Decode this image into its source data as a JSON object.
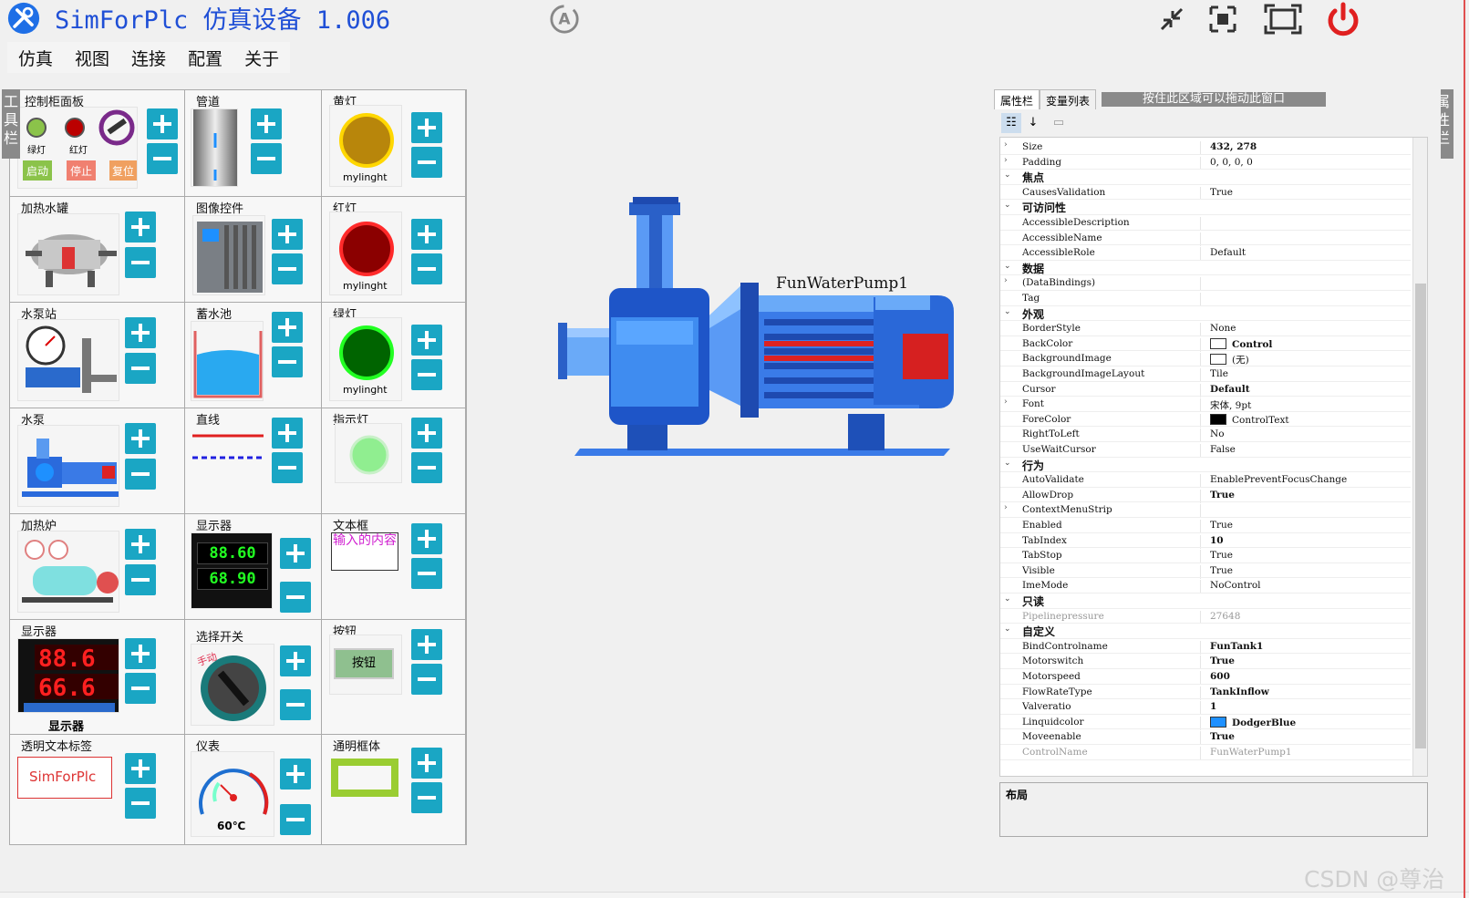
{
  "app": {
    "title": "SimForPlc 仿真设备 1.006",
    "logo_icon": "wrench-screwdriver-icon",
    "accent": "#1f4fd6",
    "window_buttons": [
      "minimize-arrows-icon",
      "restore-icon",
      "maximize-icon",
      "power-icon"
    ]
  },
  "menu": [
    "仿真",
    "视图",
    "连接",
    "配置",
    "关于"
  ],
  "side_tabs": {
    "left": "工具栏",
    "right": "属性栏"
  },
  "toolbox": {
    "cells": [
      {
        "label": "控制柜面板",
        "sub": [
          "绿灯",
          "红灯",
          "启动",
          "停止",
          "复位"
        ]
      },
      {
        "label": "管道"
      },
      {
        "label": "黄灯",
        "sub": [
          "mylinght"
        ]
      },
      {
        "label": "加热水罐"
      },
      {
        "label": "图像控件"
      },
      {
        "label": "红灯",
        "sub": [
          "mylinght"
        ]
      },
      {
        "label": "水泵站"
      },
      {
        "label": "蓄水池"
      },
      {
        "label": "绿灯",
        "sub": [
          "mylinght"
        ]
      },
      {
        "label": "水泵"
      },
      {
        "label": "直线"
      },
      {
        "label": "指示灯"
      },
      {
        "label": "加热炉"
      },
      {
        "label": "显示器",
        "sub": [
          "88.60",
          "68.90"
        ]
      },
      {
        "label": "文本框",
        "sub": [
          "输入的内容"
        ]
      },
      {
        "label": "显示器",
        "sub": [
          "显示器"
        ]
      },
      {
        "label": "选择开关",
        "sub": [
          "手动"
        ]
      },
      {
        "label": "按钮",
        "sub": [
          "按钮"
        ]
      },
      {
        "label": "透明文本标签",
        "sub": [
          "SimForPlc"
        ]
      },
      {
        "label": "仪表",
        "sub": [
          "60℃"
        ]
      },
      {
        "label": "通明框体"
      }
    ]
  },
  "canvas": {
    "control_name": "FunWaterPump1"
  },
  "properties": {
    "tabs": [
      "属性栏",
      "变量列表"
    ],
    "drag_hint": "按住此区域可以拖动此窗口",
    "rows": [
      {
        "type": "prop",
        "expand": ">",
        "name": "Size",
        "value": "432, 278",
        "bold": true
      },
      {
        "type": "prop",
        "expand": ">",
        "name": "Padding",
        "value": "0, 0, 0, 0"
      },
      {
        "type": "cat",
        "expand": "v",
        "name": "焦点"
      },
      {
        "type": "prop",
        "name": "CausesValidation",
        "value": "True"
      },
      {
        "type": "cat",
        "expand": "v",
        "name": "可访问性"
      },
      {
        "type": "prop",
        "name": "AccessibleDescription",
        "value": ""
      },
      {
        "type": "prop",
        "name": "AccessibleName",
        "value": ""
      },
      {
        "type": "prop",
        "name": "AccessibleRole",
        "value": "Default"
      },
      {
        "type": "cat",
        "expand": "v",
        "name": "数据"
      },
      {
        "type": "prop",
        "expand": ">",
        "name": "(DataBindings)",
        "value": ""
      },
      {
        "type": "prop",
        "name": "Tag",
        "value": ""
      },
      {
        "type": "cat",
        "expand": "v",
        "name": "外观"
      },
      {
        "type": "prop",
        "name": "BorderStyle",
        "value": "None"
      },
      {
        "type": "prop",
        "name": "BackColor",
        "value": "Control",
        "swatch": "#ffffff",
        "bold": true
      },
      {
        "type": "prop",
        "name": "BackgroundImage",
        "value": "(无)",
        "swatch": "#ffffff"
      },
      {
        "type": "prop",
        "name": "BackgroundImageLayout",
        "value": "Tile"
      },
      {
        "type": "prop",
        "name": "Cursor",
        "value": "Default",
        "bold": true
      },
      {
        "type": "prop",
        "expand": ">",
        "name": "Font",
        "value": "宋体, 9pt"
      },
      {
        "type": "prop",
        "name": "ForeColor",
        "value": "ControlText",
        "swatch": "#000000"
      },
      {
        "type": "prop",
        "name": "RightToLeft",
        "value": "No"
      },
      {
        "type": "prop",
        "name": "UseWaitCursor",
        "value": "False"
      },
      {
        "type": "cat",
        "expand": "v",
        "name": "行为"
      },
      {
        "type": "prop",
        "name": "AutoValidate",
        "value": "EnablePreventFocusChange"
      },
      {
        "type": "prop",
        "name": "AllowDrop",
        "value": "True",
        "bold": true
      },
      {
        "type": "prop",
        "expand": ">",
        "name": "ContextMenuStrip",
        "value": ""
      },
      {
        "type": "prop",
        "name": "Enabled",
        "value": "True"
      },
      {
        "type": "prop",
        "name": "TabIndex",
        "value": "10",
        "bold": true
      },
      {
        "type": "prop",
        "name": "TabStop",
        "value": "True"
      },
      {
        "type": "prop",
        "name": "Visible",
        "value": "True"
      },
      {
        "type": "prop",
        "name": "ImeMode",
        "value": "NoControl"
      },
      {
        "type": "cat",
        "expand": "v",
        "name": "只读"
      },
      {
        "type": "prop",
        "name": "Pipelinepressure",
        "value": "27648",
        "grey": true
      },
      {
        "type": "cat",
        "expand": "v",
        "name": "自定义"
      },
      {
        "type": "prop",
        "name": "BindControlname",
        "value": "FunTank1",
        "bold": true
      },
      {
        "type": "prop",
        "name": "Motorswitch",
        "value": "True",
        "bold": true
      },
      {
        "type": "prop",
        "name": "Motorspeed",
        "value": "600",
        "bold": true
      },
      {
        "type": "prop",
        "name": "FlowRateType",
        "value": "TankInflow",
        "bold": true
      },
      {
        "type": "prop",
        "name": "Valveratio",
        "value": "1",
        "bold": true
      },
      {
        "type": "prop",
        "name": "Linquidcolor",
        "value": "DodgerBlue",
        "swatch": "#1e90ff",
        "bold": true
      },
      {
        "type": "prop",
        "name": "Moveenable",
        "value": "True",
        "bold": true
      },
      {
        "type": "prop",
        "name": "ControlName",
        "value": "FunWaterPump1",
        "grey": true
      }
    ],
    "description_title": "布局"
  },
  "watermark": "CSDN @尊治"
}
